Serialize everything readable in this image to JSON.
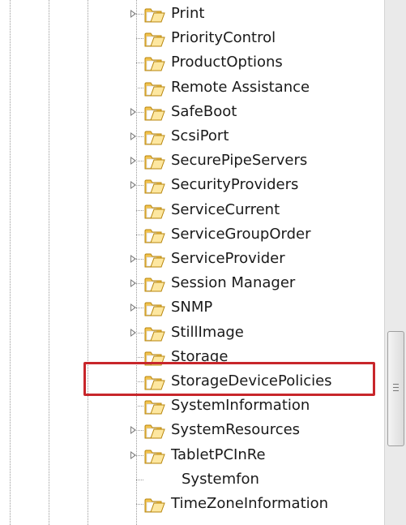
{
  "registry_tree": {
    "items": [
      {
        "label": "Print",
        "expandable": true
      },
      {
        "label": "PriorityControl",
        "expandable": false
      },
      {
        "label": "ProductOptions",
        "expandable": false
      },
      {
        "label": "Remote Assistance",
        "expandable": false
      },
      {
        "label": "SafeBoot",
        "expandable": true
      },
      {
        "label": "ScsiPort",
        "expandable": true
      },
      {
        "label": "SecurePipeServers",
        "expandable": true
      },
      {
        "label": "SecurityProviders",
        "expandable": true
      },
      {
        "label": "ServiceCurrent",
        "expandable": false
      },
      {
        "label": "ServiceGroupOrder",
        "expandable": false
      },
      {
        "label": "ServiceProvider",
        "expandable": true
      },
      {
        "label": "Session Manager",
        "expandable": true
      },
      {
        "label": "SNMP",
        "expandable": true
      },
      {
        "label": "StillImage",
        "expandable": true
      },
      {
        "label": "Storage",
        "expandable": false
      },
      {
        "label": "StorageDevicePolicies",
        "expandable": false,
        "highlighted": true
      },
      {
        "label": "SystemInformation",
        "expandable": false
      },
      {
        "label": "SystemResources",
        "expandable": true
      },
      {
        "label": "TabletPCInRe",
        "expandable": true
      },
      {
        "label": "Systemfon",
        "expandable": false,
        "child": true,
        "icon": "none"
      },
      {
        "label": "TimeZoneInformation",
        "expandable": false
      }
    ]
  },
  "colors": {
    "highlight_border": "#c8262b",
    "folder_body": "#f2c34f",
    "folder_light": "#fde7a0",
    "folder_edge": "#b8860b"
  },
  "icons": {
    "folder": "folder-icon",
    "expander": "expand-arrow-icon"
  }
}
